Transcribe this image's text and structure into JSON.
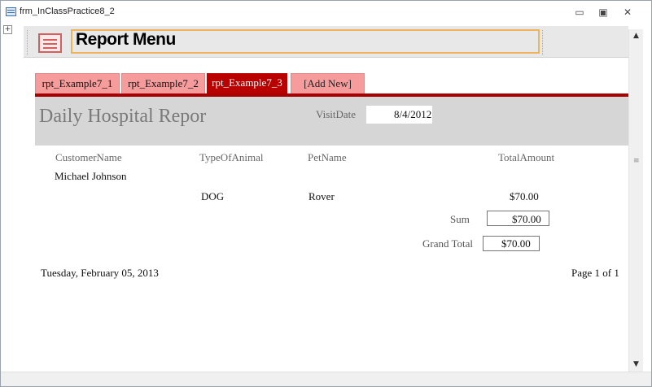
{
  "window": {
    "title": "frm_InClassPractice8_2",
    "minimize_icon": "minimize-icon",
    "restore_icon": "restore-icon",
    "close_icon": "close-icon"
  },
  "form_header": {
    "icon": "form-icon",
    "title": "Report Menu"
  },
  "tabs": [
    {
      "label": "rpt_Example7_1",
      "active": false
    },
    {
      "label": "rpt_Example7_2",
      "active": false
    },
    {
      "label": "rpt_Example7_3",
      "active": true
    },
    {
      "label": "[Add New]",
      "active": false
    }
  ],
  "report": {
    "title": "Daily Hospital Repor",
    "visit_date_label": "VisitDate",
    "visit_date_value": "8/4/2012",
    "columns": [
      "CustomerName",
      "TypeOfAnimal",
      "PetName",
      "TotalAmount"
    ],
    "customer": "Michael Johnson",
    "rows": [
      {
        "type": "DOG",
        "pet": "Rover",
        "amount": "$70.00"
      }
    ],
    "sum_label": "Sum",
    "sum_value": "$70.00",
    "grand_total_label": "Grand Total",
    "grand_total_value": "$70.00",
    "footer_date": "Tuesday, February 05, 2013",
    "footer_page": "Page 1 of 1"
  },
  "colors": {
    "tab_active": "#b80000",
    "tab_inactive": "#f79c9c",
    "title_outline": "#f0b35d"
  }
}
